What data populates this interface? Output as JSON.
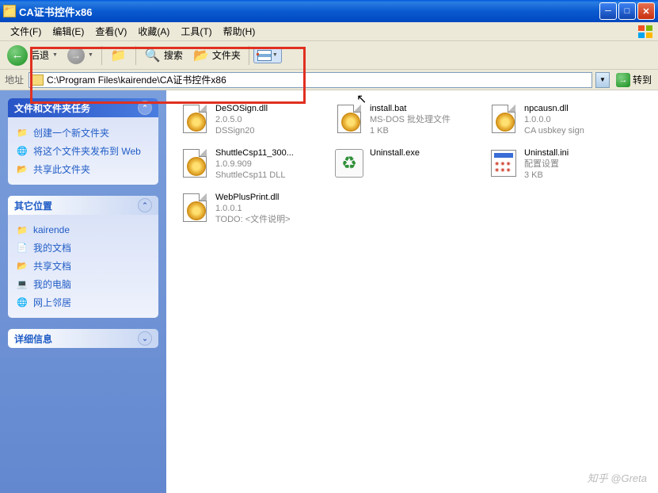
{
  "window": {
    "title": "CA证书控件x86"
  },
  "menu": {
    "file": "文件(F)",
    "edit": "编辑(E)",
    "view": "查看(V)",
    "favorites": "收藏(A)",
    "tools": "工具(T)",
    "help": "帮助(H)"
  },
  "toolbar": {
    "back": "后退",
    "search": "搜索",
    "folders": "文件夹"
  },
  "address": {
    "label": "地址",
    "path": "C:\\Program Files\\kairende\\CA证书控件x86",
    "go": "转到"
  },
  "sidebar": {
    "tasks": {
      "title": "文件和文件夹任务",
      "items": [
        {
          "label": "创建一个新文件夹",
          "icon": "📁"
        },
        {
          "label": "将这个文件夹发布到 Web",
          "icon": "🌐"
        },
        {
          "label": "共享此文件夹",
          "icon": "📂"
        }
      ]
    },
    "places": {
      "title": "其它位置",
      "items": [
        {
          "label": "kairende",
          "icon": "📁"
        },
        {
          "label": "我的文档",
          "icon": "📄"
        },
        {
          "label": "共享文档",
          "icon": "📂"
        },
        {
          "label": "我的电脑",
          "icon": "💻"
        },
        {
          "label": "网上邻居",
          "icon": "🌐"
        }
      ]
    },
    "details": {
      "title": "详细信息"
    }
  },
  "files": [
    {
      "name": "DeSOSign.dll",
      "line2": "2.0.5.0",
      "line3": "DSSign20",
      "type": "dll"
    },
    {
      "name": "install.bat",
      "line2": "MS-DOS 批处理文件",
      "line3": "1 KB",
      "type": "bat"
    },
    {
      "name": "npcausn.dll",
      "line2": "1.0.0.0",
      "line3": "CA usbkey sign",
      "type": "dll"
    },
    {
      "name": "ShuttleCsp11_300...",
      "line2": "1.0.9.909",
      "line3": "ShuttleCsp11 DLL",
      "type": "dll"
    },
    {
      "name": "Uninstall.exe",
      "line2": "",
      "line3": "",
      "type": "exe"
    },
    {
      "name": "Uninstall.ini",
      "line2": "配置设置",
      "line3": "3 KB",
      "type": "ini"
    },
    {
      "name": "WebPlusPrint.dll",
      "line2": "1.0.0.1",
      "line3": "TODO: <文件说明>",
      "type": "dll"
    }
  ],
  "watermark": "知乎 @Greta"
}
